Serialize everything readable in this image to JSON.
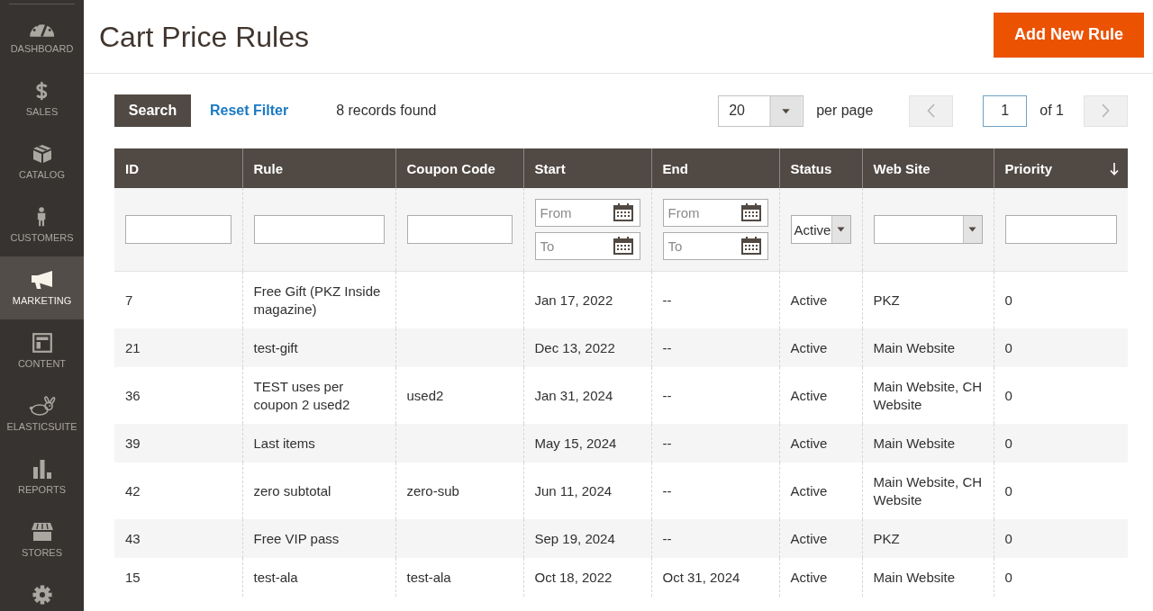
{
  "sidebar": {
    "items": [
      {
        "kind": "dashboard",
        "label": "DASHBOARD",
        "selected": false
      },
      {
        "kind": "sales",
        "label": "SALES",
        "selected": false
      },
      {
        "kind": "catalog",
        "label": "CATALOG",
        "selected": false
      },
      {
        "kind": "customers",
        "label": "CUSTOMERS",
        "selected": false
      },
      {
        "kind": "marketing",
        "label": "MARKETING",
        "selected": true
      },
      {
        "kind": "content",
        "label": "CONTENT",
        "selected": false
      },
      {
        "kind": "elasticsuite",
        "label": "ELASTICSUITE",
        "selected": false
      },
      {
        "kind": "reports",
        "label": "REPORTS",
        "selected": false
      },
      {
        "kind": "stores",
        "label": "STORES",
        "selected": false
      },
      {
        "kind": "settings",
        "selected": false
      }
    ]
  },
  "page": {
    "title": "Cart Price Rules",
    "add_button": "Add New Rule"
  },
  "toolbar": {
    "search_button": "Search",
    "reset_link": "Reset Filter",
    "records_found": "8 records found",
    "per_page": {
      "value": "20",
      "label": "per page"
    },
    "pagination": {
      "page": "1",
      "total": "of 1"
    }
  },
  "grid": {
    "columns": [
      {
        "label": "ID",
        "sorted": false,
        "filter": {
          "kind": "text"
        }
      },
      {
        "label": "Rule",
        "sorted": false,
        "filter": {
          "kind": "text"
        }
      },
      {
        "label": "Coupon Code",
        "sorted": false,
        "filter": {
          "kind": "text"
        }
      },
      {
        "label": "Start",
        "sorted": false,
        "filter": {
          "kind": "date_range",
          "from_placeholder": "From",
          "to_placeholder": "To"
        }
      },
      {
        "label": "End",
        "sorted": false,
        "filter": {
          "kind": "date_range",
          "from_placeholder": "From",
          "to_placeholder": "To"
        }
      },
      {
        "label": "Status",
        "sorted": false,
        "filter": {
          "kind": "select",
          "value": "Active"
        }
      },
      {
        "label": "Web Site",
        "sorted": false,
        "filter": {
          "kind": "select"
        }
      },
      {
        "label": "Priority",
        "sorted": true,
        "filter": {
          "kind": "text"
        }
      }
    ],
    "rows": [
      {
        "id": "7",
        "rule": "Free Gift (PKZ Inside magazine)",
        "start": "Jan 17, 2022",
        "end": "--",
        "status": "Active",
        "web_site": "PKZ",
        "priority": "0"
      },
      {
        "id": "21",
        "rule": "test-gift",
        "start": "Dec 13, 2022",
        "end": "--",
        "status": "Active",
        "web_site": "Main Website",
        "priority": "0"
      },
      {
        "id": "36",
        "rule": "TEST uses per coupon 2 used2",
        "coupon_code": "used2",
        "start": "Jan 31, 2024",
        "end": "--",
        "status": "Active",
        "web_site": "Main Website, CH Website",
        "priority": "0"
      },
      {
        "id": "39",
        "rule": "Last items",
        "start": "May 15, 2024",
        "end": "--",
        "status": "Active",
        "web_site": "Main Website",
        "priority": "0"
      },
      {
        "id": "42",
        "rule": "zero subtotal",
        "coupon_code": "zero-sub",
        "start": "Jun 11, 2024",
        "end": "--",
        "status": "Active",
        "web_site": "Main Website, CH Website",
        "priority": "0"
      },
      {
        "id": "43",
        "rule": "Free VIP pass",
        "start": "Sep 19, 2024",
        "end": "--",
        "status": "Active",
        "web_site": "PKZ",
        "priority": "0"
      },
      {
        "id": "15",
        "rule": "test-ala",
        "coupon_code": "test-ala",
        "start": "Oct 18, 2022",
        "end": "Oct 31, 2024",
        "status": "Active",
        "web_site": "Main Website",
        "priority": "0"
      }
    ]
  }
}
